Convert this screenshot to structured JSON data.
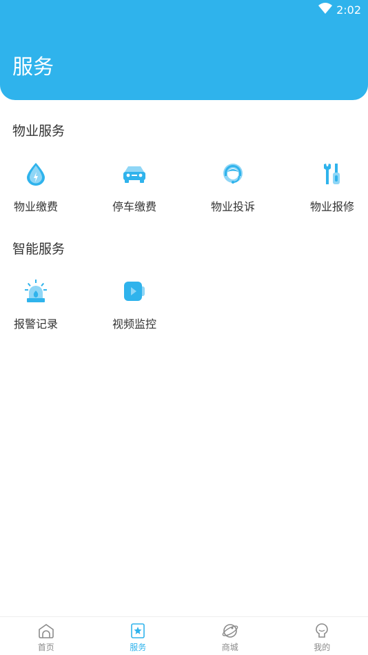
{
  "status_bar": {
    "time": "2:02"
  },
  "header": {
    "title": "服务"
  },
  "sections": [
    {
      "title": "物业服务",
      "items": [
        {
          "label": "物业缴费",
          "icon": "water-drop-bolt-icon"
        },
        {
          "label": "停车缴费",
          "icon": "car-icon"
        },
        {
          "label": "物业投诉",
          "icon": "customer-service-icon"
        },
        {
          "label": "物业报修",
          "icon": "repair-tools-icon"
        }
      ]
    },
    {
      "title": "智能服务",
      "items": [
        {
          "label": "报警记录",
          "icon": "alarm-light-icon"
        },
        {
          "label": "视频监控",
          "icon": "video-camera-icon"
        }
      ]
    }
  ],
  "tabbar": {
    "tabs": [
      {
        "label": "首页",
        "icon": "home-icon",
        "active": false
      },
      {
        "label": "服务",
        "icon": "service-star-icon",
        "active": true
      },
      {
        "label": "商城",
        "icon": "planet-icon",
        "active": false
      },
      {
        "label": "我的",
        "icon": "profile-icon",
        "active": false
      }
    ]
  },
  "colors": {
    "accent": "#2fb3ec",
    "tab_inactive": "#8a8a8a",
    "text": "#333333"
  }
}
